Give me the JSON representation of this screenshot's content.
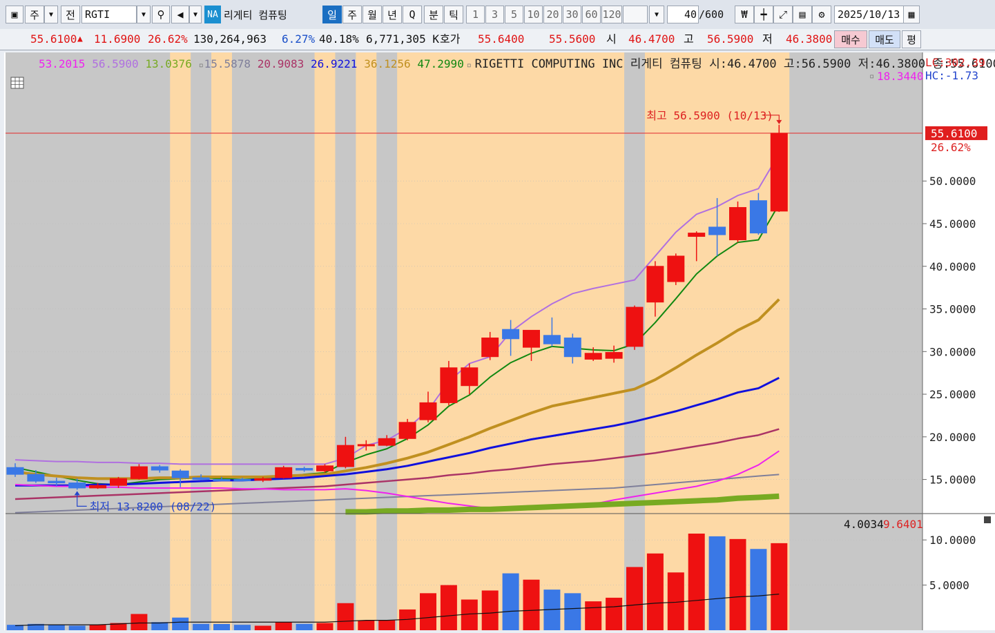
{
  "toolbar": {
    "kind_label": "주",
    "prev_label": "전",
    "symbol": "RGTI",
    "market_badge": "NA",
    "company_name": "리게티 컴퓨팅",
    "periods": [
      "일",
      "주",
      "월",
      "년",
      "Q"
    ],
    "active_period": "일",
    "interval_labels": [
      "분",
      "틱"
    ],
    "intervals": [
      "1",
      "3",
      "5",
      "10",
      "20",
      "30",
      "60",
      "120"
    ],
    "count_value": "40",
    "count_total": "/600",
    "date": "2025/10/13"
  },
  "quote": {
    "price": "55.6100",
    "change_arrow": "▲",
    "change": "11.6900",
    "change_pct": "26.62%",
    "volume": "130,264,963",
    "turnover_pct": "6.27%",
    "volume_ratio_pct": "40.18%",
    "amount": "6,771,305 K",
    "ask_label": "호가",
    "ask": "55.6400",
    "bid": "55.5600",
    "open_label": "시",
    "open": "46.4700",
    "high_label": "고",
    "high": "56.5900",
    "low_label": "저",
    "low": "46.3800",
    "buy_label": "매수",
    "sell_label": "매도",
    "eval_label": "평"
  },
  "legend": {
    "values": [
      "53.2015",
      "56.5900",
      "13.0376",
      "15.5878",
      "20.9083",
      "26.9221",
      "36.1256",
      "47.2990"
    ],
    "colors": [
      "#ee22ee",
      "#b070e0",
      "#77aa22",
      "#7f7f9a",
      "#aa3366",
      "#1010dd",
      "#c09020",
      "#118811"
    ],
    "marker2": "18.3440",
    "title": "RIGETTI COMPUTING INC  리게티 컴퓨팅 시:46.4700 고:56.5900 저:46.3800 종:55.6100",
    "lc": "LC:302.39",
    "hc": "HC:-1.73",
    "high_note": "최고 56.5900 (10/13)",
    "low_note": "최저 13.8200 (08/22)",
    "volume_vals": [
      "4.0034",
      "9.6401"
    ]
  },
  "colors": {
    "up": "#ee1111",
    "down": "#3a78e6",
    "highlight_band": "#fdd9a6",
    "gray_band": "#c7c7c7",
    "price_line": "#e23a3a"
  },
  "chart_data": {
    "type": "candlestick",
    "price_axis": {
      "ticks": [
        "15.0000",
        "20.0000",
        "25.0000",
        "30.0000",
        "35.0000",
        "40.0000",
        "45.0000",
        "50.0000"
      ],
      "current_price_label": "55.6100",
      "current_change_label": "26.62%",
      "range": [
        11,
        62
      ]
    },
    "volume_axis": {
      "ticks": [
        "5.0000",
        "10.0000"
      ],
      "range": [
        0,
        12
      ]
    },
    "candles": [
      {
        "o": 16.4,
        "h": 16.9,
        "l": 15.3,
        "c": 15.6
      },
      {
        "o": 15.6,
        "h": 16.1,
        "l": 14.6,
        "c": 14.8
      },
      {
        "o": 14.8,
        "h": 15.2,
        "l": 14.2,
        "c": 14.6
      },
      {
        "o": 14.6,
        "h": 15.1,
        "l": 13.8,
        "c": 14.0
      },
      {
        "o": 14.0,
        "h": 14.6,
        "l": 13.9,
        "c": 14.3
      },
      {
        "o": 14.3,
        "h": 15.3,
        "l": 14.0,
        "c": 15.1
      },
      {
        "o": 15.1,
        "h": 16.8,
        "l": 15.0,
        "c": 16.5
      },
      {
        "o": 16.5,
        "h": 16.7,
        "l": 15.8,
        "c": 16.1
      },
      {
        "o": 16.0,
        "h": 16.2,
        "l": 14.1,
        "c": 15.2
      },
      {
        "o": 15.2,
        "h": 15.6,
        "l": 14.9,
        "c": 15.0
      },
      {
        "o": 15.0,
        "h": 15.3,
        "l": 14.8,
        "c": 14.9
      },
      {
        "o": 15.0,
        "h": 15.2,
        "l": 14.8,
        "c": 14.9
      },
      {
        "o": 14.9,
        "h": 15.3,
        "l": 14.7,
        "c": 15.1
      },
      {
        "o": 15.2,
        "h": 16.6,
        "l": 15.1,
        "c": 16.4
      },
      {
        "o": 16.3,
        "h": 16.5,
        "l": 15.9,
        "c": 16.1
      },
      {
        "o": 16.0,
        "h": 16.8,
        "l": 15.8,
        "c": 16.6
      },
      {
        "o": 16.5,
        "h": 20.0,
        "l": 16.3,
        "c": 19.0
      },
      {
        "o": 19.0,
        "h": 19.6,
        "l": 18.4,
        "c": 19.1
      },
      {
        "o": 19.0,
        "h": 20.2,
        "l": 18.9,
        "c": 19.8
      },
      {
        "o": 19.8,
        "h": 22.1,
        "l": 19.6,
        "c": 21.7
      },
      {
        "o": 22.0,
        "h": 25.3,
        "l": 21.7,
        "c": 24.0
      },
      {
        "o": 24.0,
        "h": 28.9,
        "l": 23.7,
        "c": 28.1
      },
      {
        "o": 26.0,
        "h": 28.6,
        "l": 25.0,
        "c": 28.1
      },
      {
        "o": 29.4,
        "h": 32.3,
        "l": 29.0,
        "c": 31.6
      },
      {
        "o": 32.6,
        "h": 33.7,
        "l": 29.5,
        "c": 31.5
      },
      {
        "o": 30.5,
        "h": 32.4,
        "l": 28.9,
        "c": 32.5
      },
      {
        "o": 31.9,
        "h": 34.0,
        "l": 30.6,
        "c": 30.9
      },
      {
        "o": 31.6,
        "h": 32.1,
        "l": 28.6,
        "c": 29.4
      },
      {
        "o": 29.1,
        "h": 30.5,
        "l": 28.9,
        "c": 29.8
      },
      {
        "o": 29.2,
        "h": 30.7,
        "l": 28.7,
        "c": 29.9
      },
      {
        "o": 30.6,
        "h": 35.4,
        "l": 30.2,
        "c": 35.2
      },
      {
        "o": 35.8,
        "h": 40.6,
        "l": 34.1,
        "c": 40.0
      },
      {
        "o": 38.2,
        "h": 41.5,
        "l": 37.8,
        "c": 41.2
      },
      {
        "o": 43.5,
        "h": 44.1,
        "l": 40.6,
        "c": 43.9
      },
      {
        "o": 44.6,
        "h": 48.0,
        "l": 41.2,
        "c": 43.7
      },
      {
        "o": 43.1,
        "h": 47.6,
        "l": 42.8,
        "c": 46.9
      },
      {
        "o": 47.7,
        "h": 48.6,
        "l": 43.7,
        "c": 43.9
      },
      {
        "o": 46.47,
        "h": 56.59,
        "l": 46.38,
        "c": 55.61
      }
    ],
    "volume": [
      0.6,
      0.7,
      0.6,
      0.5,
      0.6,
      0.8,
      1.8,
      0.9,
      1.4,
      0.7,
      0.7,
      0.6,
      0.5,
      0.9,
      0.7,
      0.8,
      3.0,
      1.1,
      1.1,
      2.3,
      4.1,
      5.0,
      3.4,
      4.4,
      6.3,
      5.6,
      4.5,
      4.1,
      3.2,
      3.6,
      7.0,
      8.5,
      6.4,
      10.7,
      10.4,
      10.1,
      9.0,
      9.6401
    ],
    "volume_ma": [
      0.5,
      0.6,
      0.6,
      0.6,
      0.6,
      0.7,
      0.8,
      0.8,
      0.9,
      0.9,
      0.9,
      0.9,
      0.9,
      0.9,
      0.9,
      0.9,
      1.0,
      1.1,
      1.1,
      1.2,
      1.4,
      1.6,
      1.8,
      1.9,
      2.1,
      2.2,
      2.3,
      2.4,
      2.5,
      2.6,
      2.8,
      3.0,
      3.1,
      3.3,
      3.5,
      3.7,
      3.8,
      4.0034
    ],
    "ma_lines": [
      {
        "color": "#118811",
        "values": [
          16.4,
          15.9,
          15.4,
          14.9,
          14.5,
          14.4,
          14.7,
          15.0,
          15.1,
          15.2,
          15.1,
          15.0,
          15.1,
          15.3,
          15.6,
          15.8,
          17.0,
          17.9,
          18.6,
          19.8,
          21.4,
          23.6,
          24.9,
          27.0,
          28.7,
          29.8,
          30.6,
          30.4,
          30.2,
          30.1,
          30.9,
          33.4,
          36.2,
          39.1,
          41.2,
          42.8,
          43.1,
          47.299
        ]
      },
      {
        "color": "#c09020",
        "values": [
          15.9,
          15.6,
          15.4,
          15.2,
          15.1,
          15.1,
          15.1,
          15.2,
          15.2,
          15.3,
          15.3,
          15.3,
          15.3,
          15.4,
          15.5,
          15.6,
          16.0,
          16.4,
          16.9,
          17.5,
          18.2,
          19.1,
          20.0,
          21.0,
          21.9,
          22.8,
          23.6,
          24.1,
          24.6,
          25.1,
          25.6,
          26.7,
          28.1,
          29.6,
          31.0,
          32.5,
          33.7,
          36.1256
        ]
      },
      {
        "color": "#1010dd",
        "values": [
          14.3,
          14.3,
          14.3,
          14.3,
          14.4,
          14.4,
          14.5,
          14.6,
          14.7,
          14.8,
          14.9,
          14.9,
          15.0,
          15.1,
          15.2,
          15.4,
          15.6,
          15.9,
          16.2,
          16.6,
          17.1,
          17.6,
          18.1,
          18.7,
          19.2,
          19.7,
          20.1,
          20.5,
          20.9,
          21.3,
          21.8,
          22.4,
          23.0,
          23.7,
          24.4,
          25.2,
          25.7,
          26.9221
        ]
      },
      {
        "color": "#aa3366",
        "values": [
          12.7,
          12.8,
          12.9,
          13.0,
          13.1,
          13.2,
          13.3,
          13.4,
          13.5,
          13.6,
          13.7,
          13.8,
          13.9,
          14.0,
          14.1,
          14.2,
          14.4,
          14.6,
          14.8,
          15.0,
          15.2,
          15.5,
          15.7,
          16.0,
          16.2,
          16.5,
          16.8,
          17.0,
          17.2,
          17.5,
          17.8,
          18.1,
          18.5,
          18.9,
          19.3,
          19.8,
          20.2,
          20.9083
        ]
      },
      {
        "color": "#7f7f9a",
        "values": [
          11.1,
          11.2,
          11.3,
          11.4,
          11.5,
          11.6,
          11.7,
          11.8,
          11.9,
          12.0,
          12.1,
          12.2,
          12.3,
          12.4,
          12.5,
          12.6,
          12.7,
          12.8,
          12.9,
          13.0,
          13.1,
          13.2,
          13.3,
          13.4,
          13.5,
          13.6,
          13.7,
          13.8,
          13.9,
          14.0,
          14.2,
          14.4,
          14.6,
          14.8,
          15.0,
          15.2,
          15.4,
          15.5878
        ]
      },
      {
        "color": "#ee22ee",
        "values": [
          14.4,
          14.3,
          14.2,
          14.2,
          14.1,
          14.1,
          14.0,
          14.0,
          14.0,
          14.0,
          14.0,
          13.9,
          13.9,
          13.8,
          13.8,
          13.8,
          13.9,
          13.7,
          13.4,
          13.0,
          12.6,
          12.2,
          11.9,
          11.6,
          11.5,
          11.5,
          11.6,
          11.8,
          12.1,
          12.6,
          13.0,
          13.4,
          13.8,
          14.2,
          14.8,
          15.6,
          16.7,
          18.344
        ]
      },
      {
        "color": "#77aa22",
        "values": [
          null,
          null,
          null,
          null,
          null,
          null,
          null,
          null,
          null,
          null,
          null,
          null,
          null,
          null,
          null,
          null,
          11.2,
          11.2,
          11.3,
          11.3,
          11.4,
          11.4,
          11.5,
          11.5,
          11.6,
          11.7,
          11.8,
          11.9,
          12.0,
          12.1,
          12.2,
          12.3,
          12.4,
          12.5,
          12.6,
          12.8,
          12.9,
          13.0376
        ]
      }
    ],
    "envelope_upper": [
      17.3,
      17.2,
      17.1,
      17.1,
      17.0,
      17.0,
      16.9,
      16.9,
      16.8,
      16.8,
      16.8,
      16.8,
      16.8,
      16.8,
      16.8,
      16.8,
      17.5,
      19.0,
      19.6,
      21.0,
      23.1,
      26.5,
      28.6,
      29.4,
      32.3,
      34.1,
      35.6,
      36.8,
      37.4,
      37.9,
      38.4,
      41.2,
      44.0,
      46.1,
      47.0,
      48.3,
      49.1,
      53.2015
    ]
  }
}
